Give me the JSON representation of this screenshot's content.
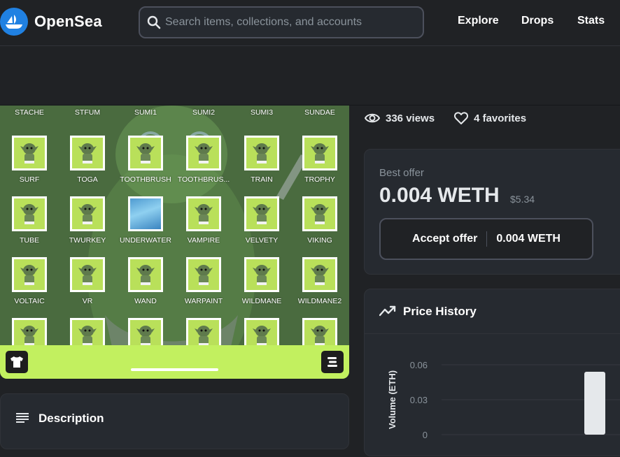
{
  "nav": {
    "brand": "OpenSea",
    "search_placeholder": "Search items, collections, and accounts",
    "links": [
      "Explore",
      "Drops",
      "Stats"
    ]
  },
  "media": {
    "rows": [
      [
        "STACHE",
        "STFUM",
        "SUMI1",
        "SUMI2",
        "SUMI3",
        "SUNDAE"
      ],
      [
        "SURF",
        "TOGA",
        "TOOTHBRUSH",
        "TOOTHBRUS...",
        "TRAIN",
        "TROPHY"
      ],
      [
        "TUBE",
        "TWURKEY",
        "UNDERWATER",
        "VAMPIRE",
        "VELVETY",
        "VIKING"
      ],
      [
        "VOLTAIC",
        "VR",
        "WAND",
        "WARPAINT",
        "WILDMANE",
        "WILDMANE2"
      ],
      [
        "",
        "",
        "",
        "",
        "",
        ""
      ]
    ],
    "bar_color": "#c2f05f",
    "shirt_icon": "tshirt-icon",
    "swap_icon": "swap-icon"
  },
  "description": {
    "title": "Description"
  },
  "stats": {
    "views": "336 views",
    "favorites": "4 favorites"
  },
  "offer": {
    "label": "Best offer",
    "price": "0.004 WETH",
    "usd": "$5.34",
    "button_label": "Accept offer",
    "button_price": "0.004 WETH"
  },
  "price_history": {
    "title": "Price History"
  },
  "chart_data": {
    "type": "bar",
    "ylabel": "Volume (ETH)",
    "yticks": [
      "0.06",
      "0.03",
      "0"
    ],
    "ylim": [
      0,
      0.06
    ],
    "values": [
      0.054
    ],
    "bar_color": "#e5e8eb"
  }
}
